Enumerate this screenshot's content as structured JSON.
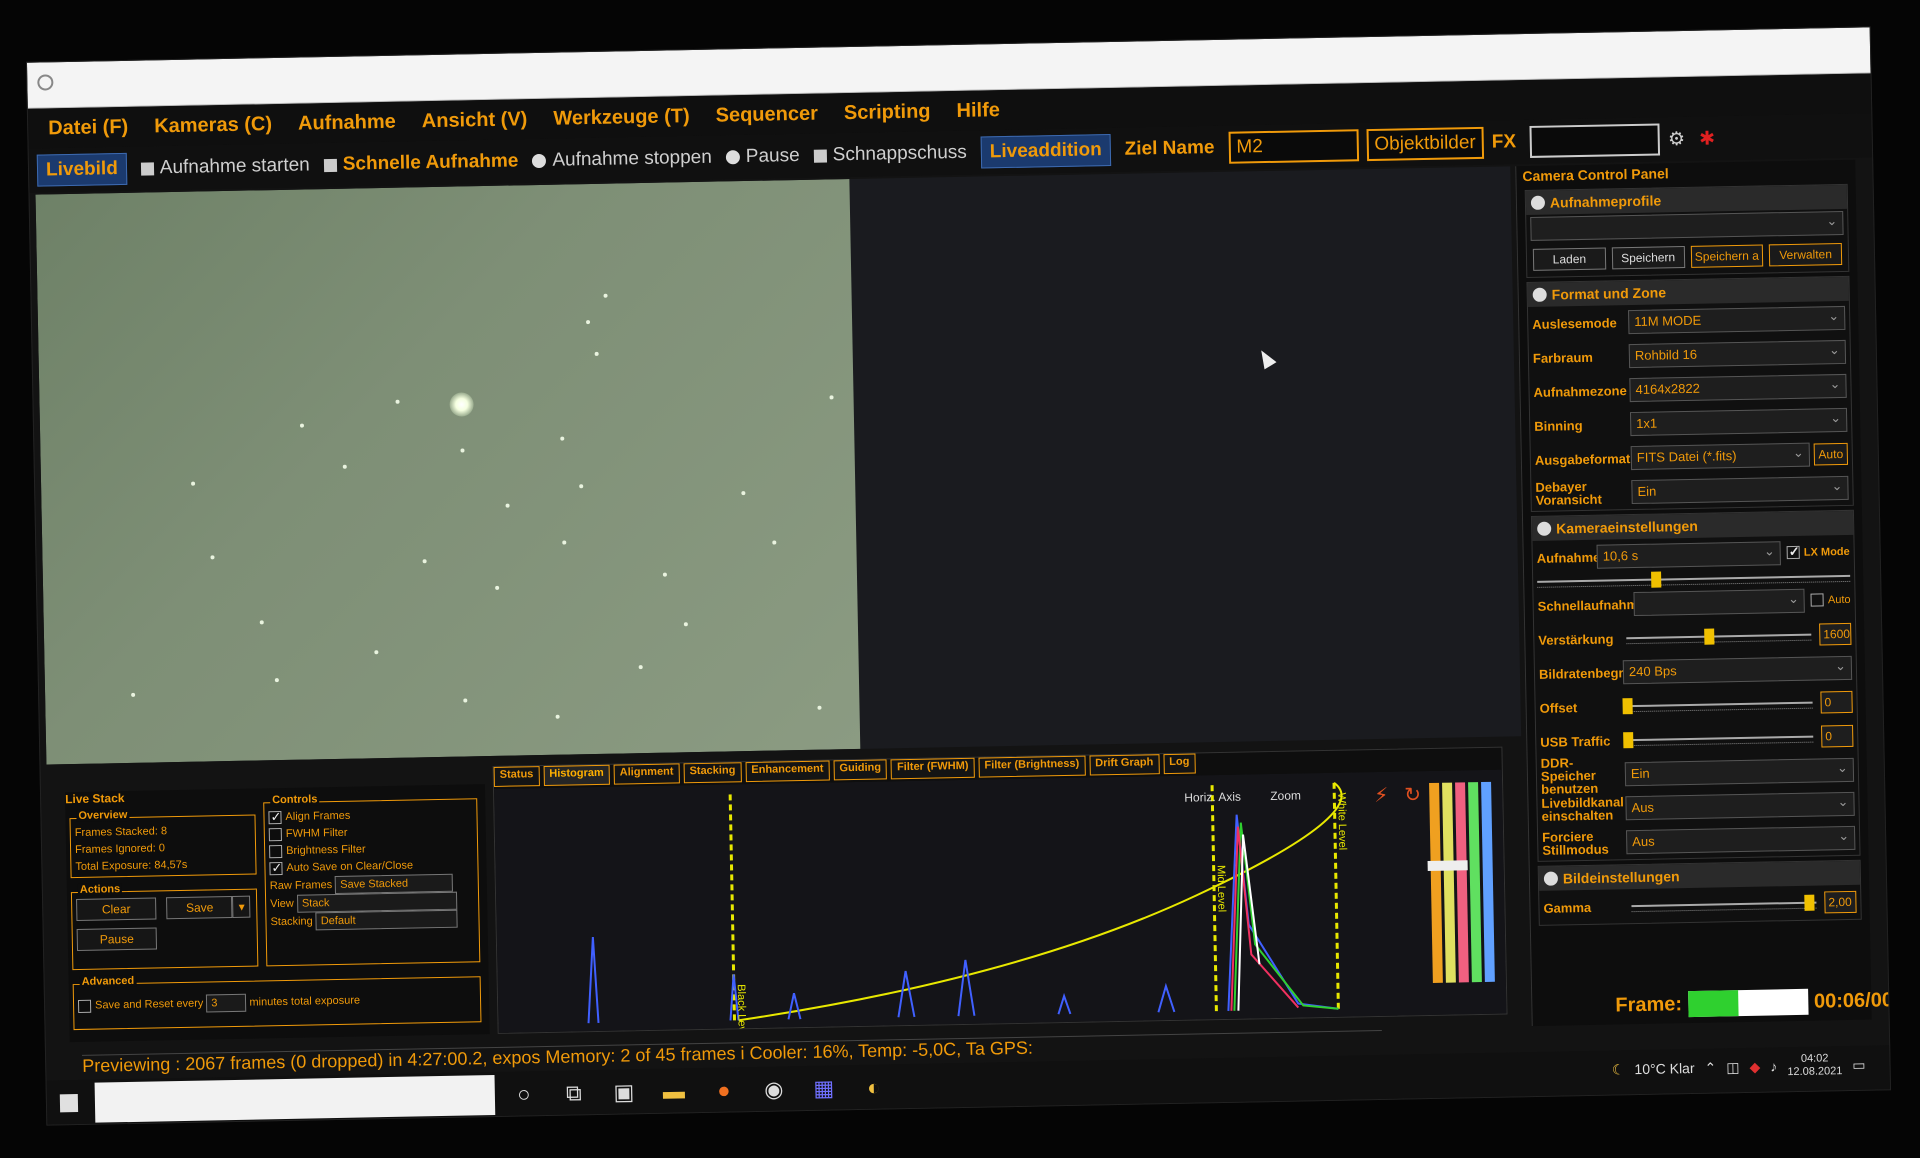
{
  "menu": [
    "Datei (F)",
    "Kameras (C)",
    "Aufnahme",
    "Ansicht (V)",
    "Werkzeuge (T)",
    "Sequencer",
    "Scripting",
    "Hilfe"
  ],
  "toolbar": {
    "livebild": "Livebild",
    "start": "Aufnahme starten",
    "quick": "Schnelle Aufnahme",
    "stop": "Aufnahme stoppen",
    "pause": "Pause",
    "snapshot": "Schnappschuss",
    "liveaddition": "Liveaddition",
    "target_label": "Ziel Name",
    "target_value": "M2",
    "objektbilder": "Objektbilder",
    "fx": "FX"
  },
  "camera_panel": {
    "title": "Camera Control Panel",
    "profiles": {
      "title": "Aufnahmeprofile",
      "buttons": [
        "Laden",
        "Speichern",
        "Speichern a",
        "Verwalten"
      ]
    },
    "format": {
      "title": "Format und Zone",
      "rows": [
        {
          "label": "Auslesemode",
          "value": "11M MODE"
        },
        {
          "label": "Farbraum",
          "value": "Rohbild 16"
        },
        {
          "label": "Aufnahmezone",
          "value": "4164x2822"
        },
        {
          "label": "Binning",
          "value": "1x1"
        },
        {
          "label": "Ausgabeformat",
          "value": "FITS Datei (*.fits)"
        },
        {
          "label": "Debayer Voransicht",
          "value": "Ein"
        }
      ],
      "auto": "Auto"
    },
    "camera": {
      "title": "Kameraeinstellungen",
      "aufnahme_label": "Aufnahme",
      "aufnahme_value": "10,6 s",
      "lx_mode": "LX Mode",
      "schnell_label": "Schnellaufnahme",
      "auto": "Auto",
      "gain_label": "Verstärkung",
      "gain_value": "1600",
      "gain_level": 0.45,
      "bandwidth_label": "Bildratenbegrenzung",
      "bandwidth_value": "240 Bps",
      "offset_label": "Offset",
      "offset_value": "0",
      "usb_label": "USB Traffic",
      "usb_value": "0",
      "ddr_label": "DDR-Speicher benutzen",
      "ddr_value": "Ein",
      "live_label": "Livebildkanal einschalten",
      "live_value": "Aus",
      "still_label": "Forciere Stillmodus",
      "still_value": "Aus"
    },
    "image": {
      "title": "Bildeinstellungen",
      "gamma_label": "Gamma",
      "gamma_value": "2,00"
    }
  },
  "frame": {
    "label": "Frame:",
    "progress": 0.42,
    "time": "00:06/00"
  },
  "livestack": {
    "title": "Live Stack",
    "overview": {
      "title": "Overview",
      "stacked": "Frames Stacked: 8",
      "ignored": "Frames Ignored: 0",
      "exposure": "Total Exposure: 84,57s"
    },
    "actions": {
      "title": "Actions",
      "clear": "Clear",
      "save": "Save",
      "pause": "Pause"
    },
    "controls": {
      "title": "Controls",
      "align": "Align Frames",
      "fwhm": "FWHM Filter",
      "brightness": "Brightness Filter",
      "autosave": "Auto Save on Clear/Close",
      "raw_label": "Raw Frames",
      "raw_value": "Save Stacked",
      "view_label": "View",
      "view_value": "Stack",
      "stacking_label": "Stacking",
      "stacking_value": "Default"
    },
    "advanced": {
      "title": "Advanced",
      "save_reset": "Save and Reset every",
      "minutes": "3",
      "suffix": "minutes total exposure"
    }
  },
  "histogram": {
    "tabs": [
      "Status",
      "Histogram",
      "Alignment",
      "Stacking",
      "Enhancement",
      "Guiding",
      "Filter (FWHM)",
      "Filter (Brightness)",
      "Drift Graph",
      "Log"
    ],
    "horiz": "Horiz. Axis",
    "zoom": "Zoom",
    "black_level": "Black Level",
    "mid_level": "Mid Level",
    "white_level": "White Level"
  },
  "status": "Previewing : 2067 frames (0 dropped) in 4:27:00.2, expos Memory: 2 of 45 frames i Cooler: 16%, Temp: -5,0C, Ta GPS:",
  "tray": {
    "weather": "10°C Klar",
    "time": "04:02",
    "date": "12.08.2021"
  }
}
